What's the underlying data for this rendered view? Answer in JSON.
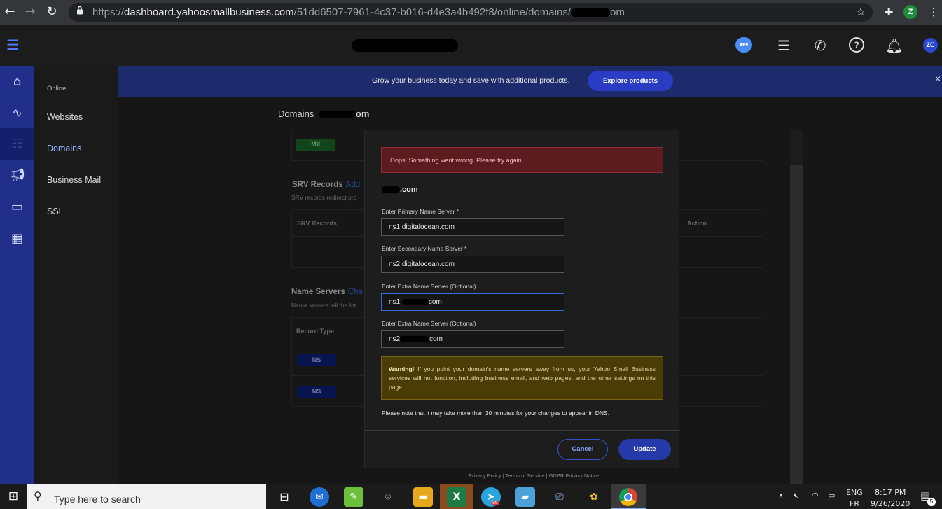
{
  "browser": {
    "url_prefix": "https://",
    "url_host": "dashboard.yahoosmallbusiness.com",
    "url_path": "/51dd6507-7961-4c37-b016-d4e3a4b492f8/online/domains/",
    "url_tail": "om",
    "profile_initial": "Z",
    "icons": [
      "back-icon",
      "forward-icon",
      "reload-icon",
      "lock-icon",
      "star-icon",
      "extensions-icon",
      "menu-dots-icon"
    ]
  },
  "header": {
    "avatar": "ZC",
    "icons": [
      "hamburger-icon",
      "chat-icon",
      "list-icon",
      "phone-icon",
      "help-icon",
      "bell-icon"
    ]
  },
  "sidebar": {
    "heading": "Online",
    "items": [
      {
        "label": "Websites"
      },
      {
        "label": "Domains"
      },
      {
        "label": "Business Mail"
      },
      {
        "label": "SSL"
      }
    ]
  },
  "banner": {
    "text": "Grow your business today and save with additional products.",
    "button": "Explore products",
    "close": "×"
  },
  "breadcrumb": {
    "label": "Domains",
    "domain_tail": "om"
  },
  "background": {
    "mx_badge": "MX",
    "srv_title": "SRV Records",
    "srv_link": "Add",
    "srv_note": "SRV records redirect pro",
    "srv_col": "SRV Records",
    "action_col": "Action",
    "ns_title": "Name Servers",
    "ns_link": "Cha",
    "ns_note": "Name servers tell the Int",
    "record_type_col": "Record Type",
    "ns_badges": [
      "NS",
      "NS"
    ]
  },
  "modal": {
    "error": "Oops! Something went wrong. Please try again.",
    "domain_tail": ".com",
    "fields": [
      {
        "label": "Enter Primary Name Server *",
        "value": "ns1.digitalocean.com"
      },
      {
        "label": "Enter Secondary Name Server *",
        "value": "ns2.digitalocean.com"
      },
      {
        "label": "Enter Extra Name Server (Optional)",
        "value_prefix": "ns1.",
        "value_suffix": "com"
      },
      {
        "label": "Enter Extra Name Server (Optional)",
        "value_prefix": "ns2",
        "value_suffix": "com"
      }
    ],
    "warning_bold": "Warning!",
    "warning_text": " If you point your domain's name servers away from us, your Yahoo Small Business services will not function, including business email, and web pages, and the other settings on this page.",
    "dns_note": "Please note that it may take more than 30 minutes for your changes to appear in DNS.",
    "cancel": "Cancel",
    "update": "Update"
  },
  "footer": {
    "text": "Privacy Policy | Terms of Service | GDPR Privacy Notice"
  },
  "taskbar": {
    "search_placeholder": "Type here to search",
    "lang_top": "ENG",
    "lang_bottom": "FR",
    "time": "8:17 PM",
    "date": "9/26/2020",
    "notification_count": "5",
    "telegram_badge": "85"
  }
}
